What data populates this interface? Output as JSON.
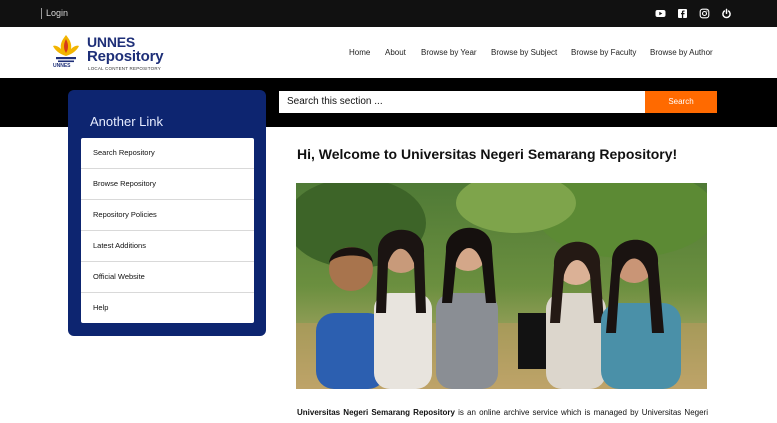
{
  "topbar": {
    "login_label": "Login",
    "social": [
      "youtube-icon",
      "facebook-icon",
      "instagram-icon",
      "power-icon"
    ]
  },
  "logo": {
    "line1": "UNNES",
    "line2": "Repository",
    "tagline": "LOCAL CONTENT REPOSITORY",
    "emblem_label": "UNNES"
  },
  "nav": {
    "items": [
      "Home",
      "About",
      "Browse by Year",
      "Browse by Subject",
      "Browse by Faculty",
      "Browse by Author"
    ]
  },
  "search": {
    "placeholder": "Search this section ...",
    "button_label": "Search"
  },
  "sidebar": {
    "title": "Another Link",
    "items": [
      "Search Repository",
      "Browse Repository",
      "Repository Policies",
      "Latest Additions",
      "Official Website",
      "Help"
    ]
  },
  "main": {
    "welcome": "Hi, Welcome to Universitas Negeri Semarang Repository!",
    "description_bold": "Universitas Negeri Semarang Repository",
    "description_rest": " is an online archive service which is managed by Universitas Negeri"
  },
  "colors": {
    "topbar": "#111111",
    "band": "#000000",
    "sidebar": "#0d2570",
    "accent": "#ff6a00",
    "brand_text": "#1e2f78"
  }
}
